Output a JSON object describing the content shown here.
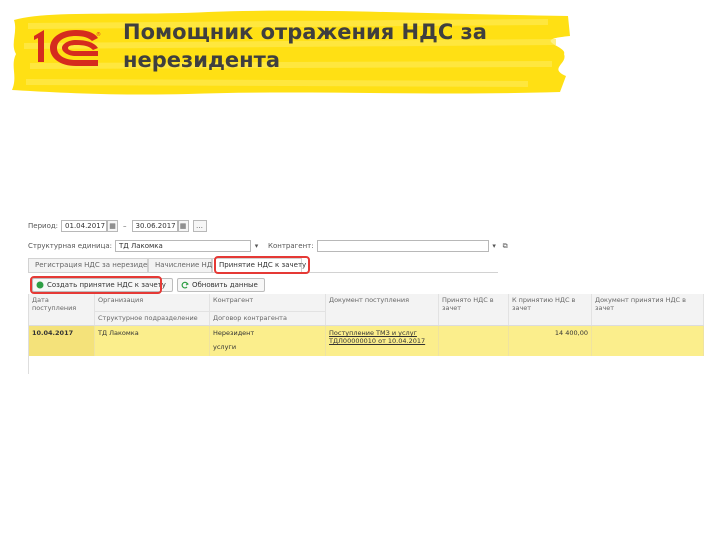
{
  "slide": {
    "title_line1": "Помощник отражения НДС за",
    "title_line2": "нерезидента"
  },
  "brand": {
    "logo_text": "1С",
    "colors": {
      "yellow": "#FFE014",
      "red": "#D52B1E",
      "highlight_row": "#FBEE8C"
    }
  },
  "form": {
    "period_label": "Период:",
    "period_from": "01.04.2017",
    "period_dash": "–",
    "period_to": "30.06.2017",
    "org_label": "Структурная единица:",
    "org_value": "ТД Лакомка",
    "counterparty_label": "Контрагент:",
    "counterparty_value": "",
    "tabs": [
      {
        "label": "Регистрация НДС за нерезидента"
      },
      {
        "label": "Начисление НДС"
      },
      {
        "label": "Принятие НДС к зачету"
      }
    ],
    "buttons": {
      "create_label": "Создать принятие НДС к зачету",
      "refresh_label": "Обновить данные"
    },
    "columns": {
      "date": "Дата поступления",
      "org": "Организация",
      "org_sub": "Структурное подразделение",
      "counterparty": "Контрагент",
      "counterparty_sub": "Договор контрагента",
      "document": "Документ поступления",
      "accepted": "Принято НДС в зачет",
      "to_accept": "К принятию НДС в зачет",
      "vat_doc": "Документ принятия НДС в зачет"
    },
    "rows": [
      {
        "date": "10.04.2017",
        "org": "ТД Лакомка",
        "counterparty": "Нерезидент",
        "contract": "услуги",
        "document_line1": "Поступление ТМЗ и услуг",
        "document_line2": "ТДЛ00000010 от 10.04.2017",
        "accepted": "",
        "to_accept": "14 400,00",
        "vat_doc": ""
      }
    ]
  }
}
